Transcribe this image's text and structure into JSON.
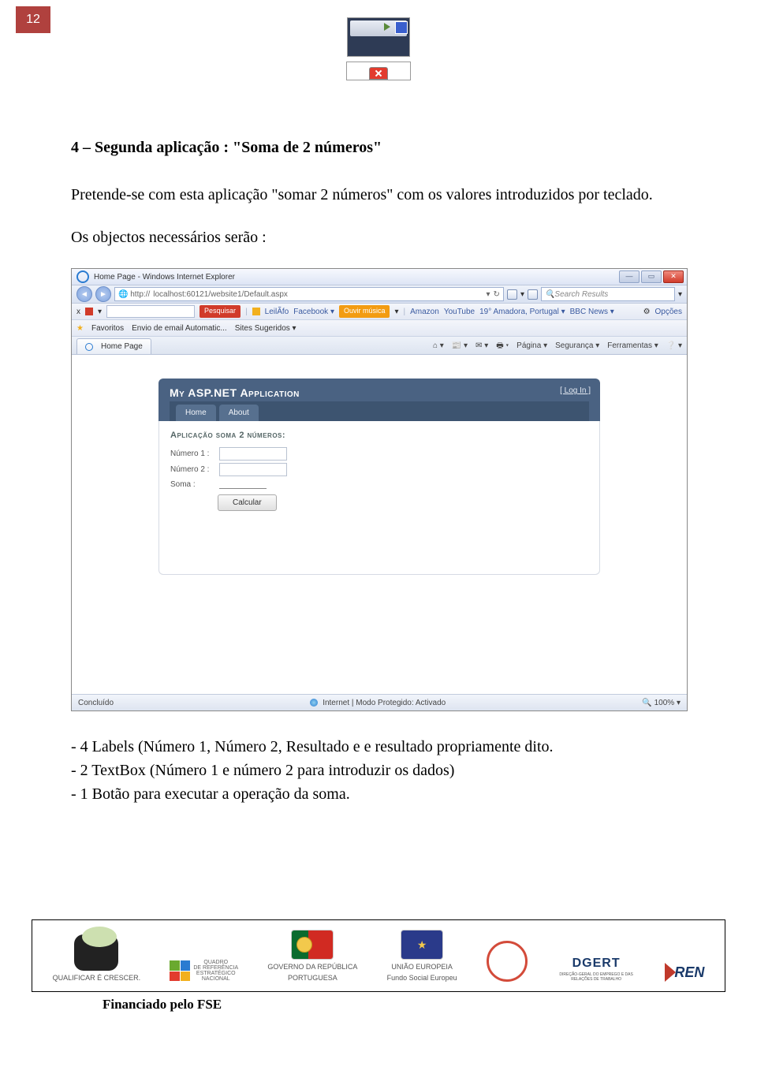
{
  "page_number": "12",
  "heading": "4 – Segunda aplicação : \"Soma de 2 números\"",
  "intro": "Pretende-se com esta aplicação \"somar 2 números\" com os valores introduzidos por teclado.",
  "objects_line": "Os objectos necessários serão :",
  "browser": {
    "window_title": "Home Page - Windows Internet Explorer",
    "win_buttons": {
      "min": "—",
      "max": "▭",
      "close": "✕"
    },
    "nav": {
      "back": "◄",
      "fwd": "►"
    },
    "url_prefix": "🌐 http://",
    "url": "localhost:60121/website1/Default.aspx",
    "refresh": "↻",
    "addr_dd": "▾",
    "search_dd": "▾",
    "search_placeholder": "Search Results",
    "search_mag": "🔍",
    "toolbar1": {
      "close": "x",
      "dd": "▾",
      "pesquisar": "Pesquisar",
      "leilao": "LeilÃfo",
      "facebook": "Facebook ▾",
      "ouvir": "Ouvir música",
      "ouvir_dd": "▾",
      "amazon": "Amazon",
      "youtube": "YouTube",
      "weather": "19° Amadora, Portugal ▾",
      "bbc": "BBC News ▾",
      "opcoes": "Opções"
    },
    "favbar": {
      "label": "Favoritos",
      "item1": "Envio de email Automatic...",
      "item2": "Sites Sugeridos ▾"
    },
    "tab": "Home Page",
    "cmdbar": {
      "home": "⌂ ▾",
      "feed": "📰 ▾",
      "mail": "✉ ▾",
      "print": "🖶 ▾",
      "pagina": "Página ▾",
      "seguranca": "Segurança ▾",
      "ferramentas": "Ferramentas ▾",
      "help": "❔ ▾"
    },
    "status_left": "Concluído",
    "status_mid": "Internet | Modo Protegido: Activado",
    "status_zoom": "🔍 100% ▾"
  },
  "asp": {
    "title": "My ASP.NET Application",
    "login": "[ Log In ]",
    "nav_home": "Home",
    "nav_about": "About",
    "form_title": "Aplicação soma 2 números:",
    "label1": "Número 1 :",
    "label2": "Número 2 :",
    "label3": "Soma :",
    "button": "Calcular"
  },
  "bullets": {
    "b1": "- 4 Labels (Número 1, Número 2, Resultado e e resultado propriamente dito.",
    "b2": "- 2 TextBox (Número 1 e número 2 para introduzir os dados)",
    "b3": "- 1 Botão para executar a operação da soma."
  },
  "footer": {
    "qualificar": "QUALIFICAR É CRESCER.",
    "qren1": "QUADRO",
    "qren2": "DE REFERÊNCIA",
    "qren3": "ESTRATÉGICO",
    "qren4": "NACIONAL",
    "gov1": "GOVERNO DA REPÚBLICA",
    "gov2": "PORTUGUESA",
    "eu1": "UNIÃO EUROPEIA",
    "eu2": "Fundo Social Europeu",
    "dgert": "DGERT",
    "dgert_sub": "DIREÇÃO-GERAL DO EMPREGO E DAS RELAÇÕES DE TRABALHO",
    "financiado": "Financiado pelo FSE"
  }
}
